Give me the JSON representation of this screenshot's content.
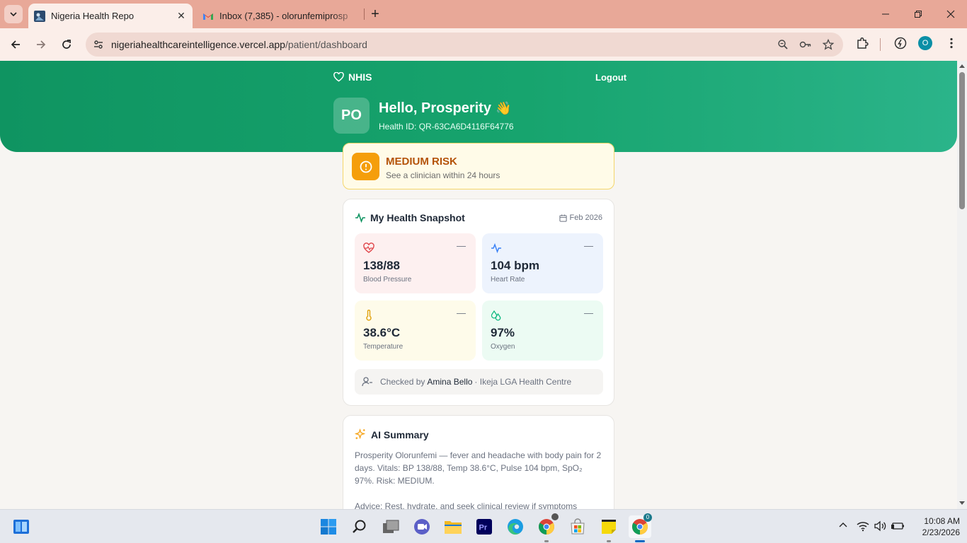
{
  "browser": {
    "tabs": [
      {
        "title": "Nigeria Health Repo",
        "active": true,
        "icon": "page-favicon"
      },
      {
        "title": "Inbox (7,385) - olorunfemiprosp",
        "active": false,
        "icon": "gmail-icon"
      }
    ],
    "url_host": "nigeriahealthcareintelligence.vercel.app",
    "url_path": "/patient/dashboard",
    "profile_initial": "O"
  },
  "header": {
    "brand": "NHIS",
    "logout_label": "Logout",
    "avatar_initials": "PO",
    "greeting": "Hello, Prosperity",
    "greeting_emoji": "👋",
    "health_id": "Health ID: QR-63CA6D4116F64776"
  },
  "risk": {
    "title": "MEDIUM RISK",
    "subtitle": "See a clinician within 24 hours",
    "color": "#f59e0b"
  },
  "snapshot": {
    "title": "My Health Snapshot",
    "date": "Feb 2026",
    "vitals": [
      {
        "value": "138/88",
        "label": "Blood Pressure",
        "trend": "—",
        "icon": "heart-pulse-icon",
        "bg": "#fdf0f0",
        "color": "#e0454a"
      },
      {
        "value": "104 bpm",
        "label": "Heart Rate",
        "trend": "—",
        "icon": "activity-icon",
        "bg": "#edf3fd",
        "color": "#3b82f6"
      },
      {
        "value": "38.6°C",
        "label": "Temperature",
        "trend": "—",
        "icon": "thermometer-icon",
        "bg": "#fefbea",
        "color": "#e0a10b"
      },
      {
        "value": "97%",
        "label": "Oxygen",
        "trend": "—",
        "icon": "droplets-icon",
        "bg": "#ecfbf3",
        "color": "#10b981"
      }
    ],
    "checked_prefix": "Checked by",
    "checked_by": "Amina Bello",
    "checked_place": "· Ikeja LGA Health Centre"
  },
  "ai_summary": {
    "title": "AI Summary",
    "text": "Prosperity Olorunfemi — fever and headache with body pain for 2 days. Vitals: BP 138/88, Temp 38.6°C, Pulse 104 bpm, SpO₂ 97%. Risk: MEDIUM.",
    "advice": "Advice: Rest, hydrate, and seek clinical review if symptoms"
  },
  "taskbar": {
    "time": "10:08 AM",
    "date": "2/23/2026",
    "chrome_badge": "0"
  },
  "colors": {
    "primary": "#0f9461",
    "accent": "#2bb48a",
    "tab_bar": "#e8a898"
  }
}
